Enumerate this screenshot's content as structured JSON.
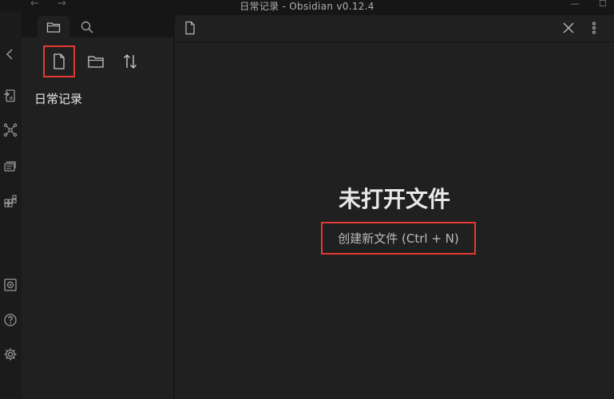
{
  "window": {
    "title": "日常记录 - Obsidian v0.12.4",
    "back_icon": "←",
    "forward_icon": "→",
    "minimize": "—",
    "maximize": "☐"
  },
  "sidebar_tabs": [
    {
      "name": "file-explorer",
      "icon": "folder-icon",
      "active": true
    },
    {
      "name": "search",
      "icon": "search-icon",
      "active": false
    }
  ],
  "file_explorer": {
    "actions": [
      {
        "name": "new-note",
        "icon": "file-icon",
        "highlighted": true
      },
      {
        "name": "new-folder",
        "icon": "folder-icon"
      },
      {
        "name": "sort",
        "icon": "sort-icon"
      }
    ],
    "vault_name": "日常记录"
  },
  "ribbon": {
    "top_icons": [
      "collapse-icon",
      "quick-switcher-icon",
      "graph-icon",
      "templates-icon",
      "command-palette-icon"
    ],
    "bottom_icons": [
      "vault-icon",
      "help-icon",
      "settings-icon"
    ]
  },
  "editor": {
    "tab_icon": "file-icon",
    "close_icon": "close-icon",
    "more_icon": "more-icon",
    "empty_title": "未打开文件",
    "create_action": "创建新文件 (Ctrl + N)"
  },
  "colors": {
    "highlight": "#e53935",
    "background": "#202020",
    "chrome": "#161616"
  }
}
